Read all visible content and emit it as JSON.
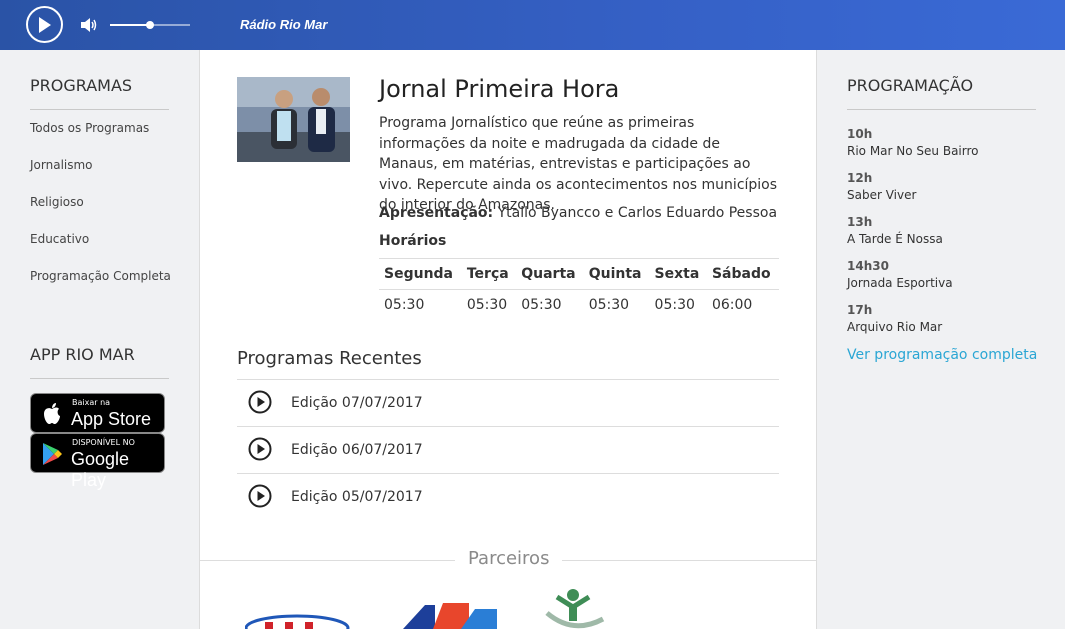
{
  "player": {
    "station_name": "Rádio Rio Mar",
    "volume_level": 0.5
  },
  "left": {
    "programas_title": "PROGRAMAS",
    "items": [
      {
        "label": "Todos os Programas"
      },
      {
        "label": "Jornalismo"
      },
      {
        "label": "Religioso"
      },
      {
        "label": "Educativo"
      },
      {
        "label": "Programação Completa"
      }
    ],
    "app_title": "APP RIO MAR",
    "appstore": {
      "small": "Baixar na",
      "big": "App Store"
    },
    "googleplay": {
      "small": "DISPONÍVEL NO",
      "big": "Google Play"
    }
  },
  "program": {
    "title": "Jornal Primeira Hora",
    "description": "Programa Jornalístico que reúne as primeiras informações da noite e madrugada da cidade de Manaus, em matérias, entrevistas e participações ao vivo. Repercute ainda os acontecimentos nos municípios do interior do Amazonas.",
    "presenter_label": "Apresentação:",
    "presenter_value": " Ytallo Byancco e Carlos Eduardo Pessoa",
    "horarios_label": "Horários",
    "days": [
      "Segunda",
      "Terça",
      "Quarta",
      "Quinta",
      "Sexta",
      "Sábado"
    ],
    "times": [
      "05:30",
      "05:30",
      "05:30",
      "05:30",
      "05:30",
      "06:00"
    ]
  },
  "recent": {
    "title": "Programas Recentes",
    "episodes": [
      {
        "label": "Edição 07/07/2017"
      },
      {
        "label": "Edição 06/07/2017"
      },
      {
        "label": "Edição 05/07/2017"
      }
    ]
  },
  "partners": {
    "title": "Parceiros"
  },
  "programacao": {
    "title": "PROGRAMAÇÃO",
    "items": [
      {
        "time": "10h",
        "name": "Rio Mar No Seu Bairro"
      },
      {
        "time": "12h",
        "name": "Saber Viver"
      },
      {
        "time": "13h",
        "name": "A Tarde É Nossa"
      },
      {
        "time": "14h30",
        "name": "Jornada Esportiva"
      },
      {
        "time": "17h",
        "name": "Arquivo Rio Mar"
      }
    ],
    "full_link": "Ver programação completa"
  },
  "colors": {
    "player_bar": "#2f5bb8",
    "link": "#2aa6d4",
    "background": "#f0f1f3"
  }
}
